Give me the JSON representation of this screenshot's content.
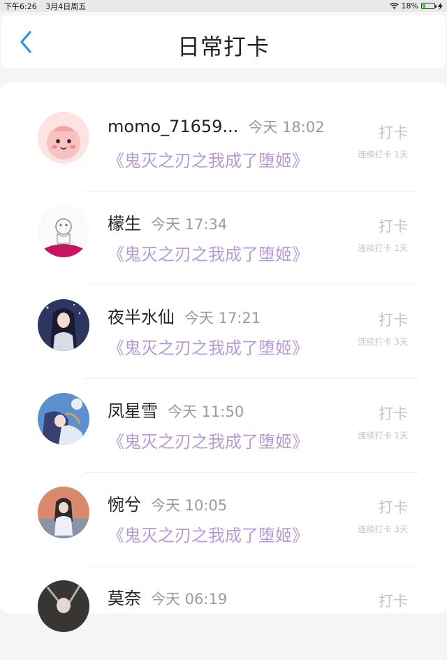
{
  "status_bar": {
    "time": "下午6:26",
    "date": "3月4日周五",
    "battery_percent": "18%",
    "battery_level": 0.18
  },
  "header": {
    "title": "日常打卡",
    "back_icon": "chevron-left-icon"
  },
  "checkin_label": "打卡",
  "accent_color": "#b79ad8",
  "entries": [
    {
      "user": "momo_71659...",
      "time": "今天 18:02",
      "book": "《鬼灭之刃之我成了堕姬》",
      "streak": "连续打卡 1天"
    },
    {
      "user": "檬生",
      "time": "今天 17:34",
      "book": "《鬼灭之刃之我成了堕姬》",
      "streak": "连续打卡 1天"
    },
    {
      "user": "夜半水仙",
      "time": "今天 17:21",
      "book": "《鬼灭之刃之我成了堕姬》",
      "streak": "连续打卡 3天"
    },
    {
      "user": "凤星雪",
      "time": "今天 11:50",
      "book": "《鬼灭之刃之我成了堕姬》",
      "streak": "连续打卡 1天"
    },
    {
      "user": "惋兮",
      "time": "今天 10:05",
      "book": "《鬼灭之刃之我成了堕姬》",
      "streak": "连续打卡 3天"
    },
    {
      "user": "莫奈",
      "time": "今天 06:19",
      "book": "",
      "streak": ""
    }
  ]
}
